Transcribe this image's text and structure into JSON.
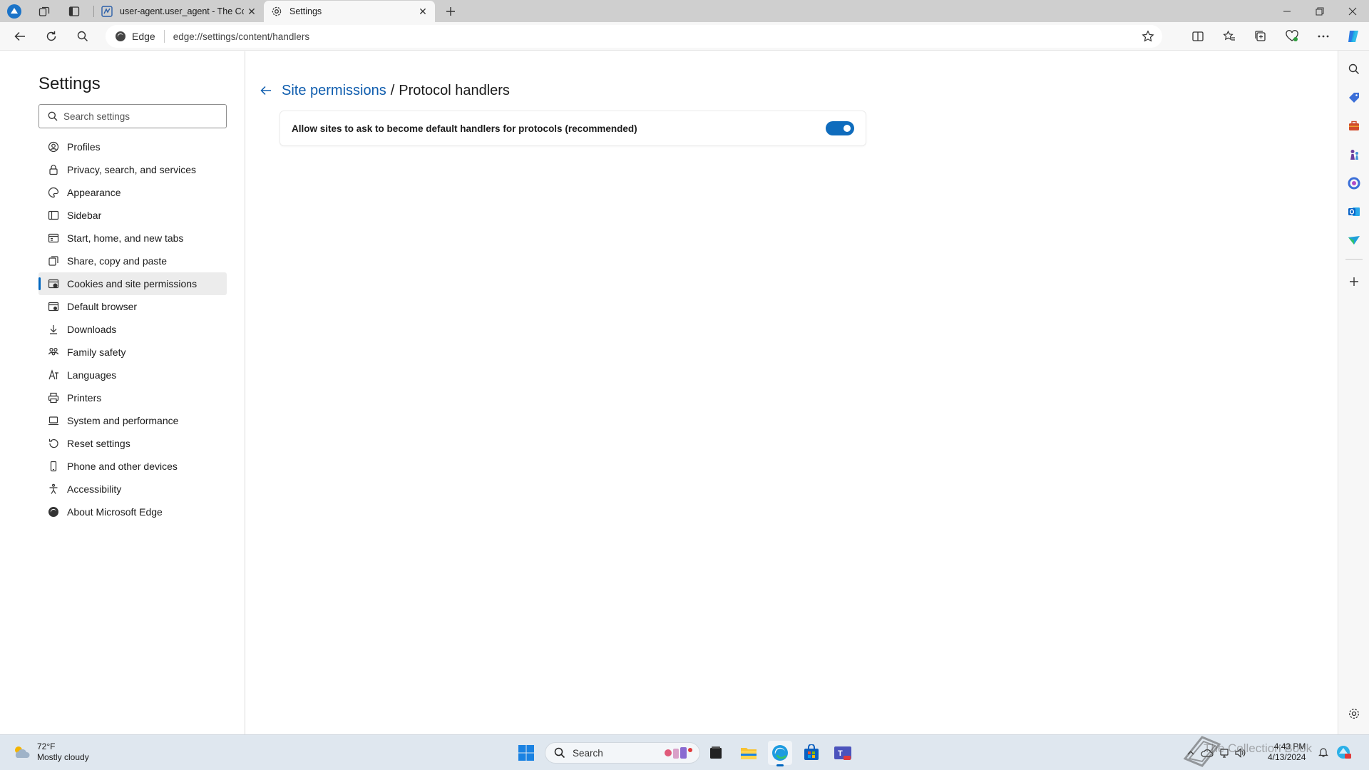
{
  "tabs": [
    {
      "title": "user-agent.user_agent - The Coll",
      "active": false
    },
    {
      "title": "Settings",
      "active": true
    }
  ],
  "address": {
    "site_label": "Edge",
    "url": "edge://settings/content/handlers"
  },
  "settings": {
    "title": "Settings",
    "search_placeholder": "Search settings",
    "menu": [
      {
        "label": "Profiles",
        "icon": "profile-icon"
      },
      {
        "label": "Privacy, search, and services",
        "icon": "lock-icon"
      },
      {
        "label": "Appearance",
        "icon": "appearance-icon"
      },
      {
        "label": "Sidebar",
        "icon": "sidebar-icon"
      },
      {
        "label": "Start, home, and new tabs",
        "icon": "home-icon"
      },
      {
        "label": "Share, copy and paste",
        "icon": "share-icon"
      },
      {
        "label": "Cookies and site permissions",
        "icon": "cookies-icon",
        "selected": true
      },
      {
        "label": "Default browser",
        "icon": "browser-icon"
      },
      {
        "label": "Downloads",
        "icon": "download-icon"
      },
      {
        "label": "Family safety",
        "icon": "family-icon"
      },
      {
        "label": "Languages",
        "icon": "languages-icon"
      },
      {
        "label": "Printers",
        "icon": "printer-icon"
      },
      {
        "label": "System and performance",
        "icon": "laptop-icon"
      },
      {
        "label": "Reset settings",
        "icon": "reset-icon"
      },
      {
        "label": "Phone and other devices",
        "icon": "phone-icon"
      },
      {
        "label": "Accessibility",
        "icon": "accessibility-icon"
      },
      {
        "label": "About Microsoft Edge",
        "icon": "edge-logo-icon"
      }
    ]
  },
  "page": {
    "breadcrumb_link": "Site permissions",
    "breadcrumb_separator": "/",
    "breadcrumb_current": "Protocol handlers",
    "setting_label": "Allow sites to ask to become default handlers for protocols (recommended)",
    "setting_enabled": true
  },
  "taskbar": {
    "temperature": "72°F",
    "weather": "Mostly cloudy",
    "search_label": "Search",
    "time": "4:43 PM",
    "date": "4/13/2024"
  },
  "colors": {
    "accent": "#0f6cbd",
    "link": "#0f5dae",
    "tab_strip": "#cfcfcf",
    "taskbar": "#dfe7ef"
  },
  "watermark": "The Collection Book"
}
